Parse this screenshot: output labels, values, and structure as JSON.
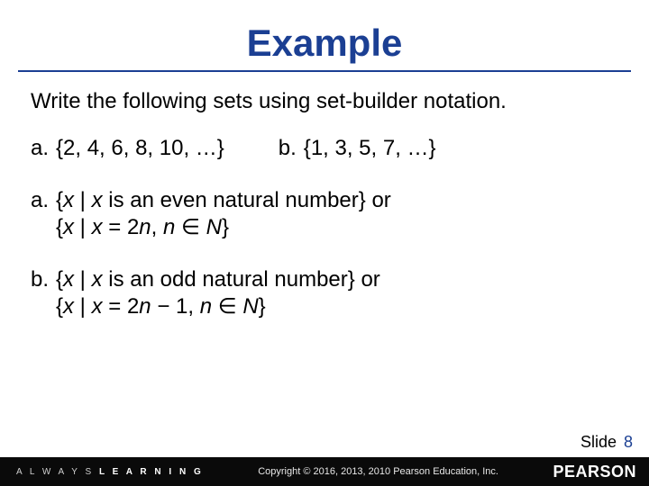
{
  "title": "Example",
  "intro": "Write the following sets using set-builder notation.",
  "qa": {
    "a_label": "a.",
    "a_text": "{2, 4, 6, 8, 10, …}",
    "b_label": "b.",
    "b_text": "{1, 3, 5, 7, …}"
  },
  "ans": {
    "a_label": "a.",
    "a_line1_pre": "{",
    "a_line1_x1": "x",
    "a_line1_mid": " | ",
    "a_line1_x2": "x",
    "a_line1_post": " is an even natural number} or",
    "a_line2_pre": "{",
    "a_line2_x1": "x",
    "a_line2_mid1": " | ",
    "a_line2_x2": "x",
    "a_line2_mid2": " = 2",
    "a_line2_n1": "n",
    "a_line2_mid3": ", ",
    "a_line2_n2": "n",
    "a_line2_mid4": " ∈ ",
    "a_line2_N": "N",
    "a_line2_post": "}",
    "b_label": "b.",
    "b_line1_pre": "{",
    "b_line1_x1": "x",
    "b_line1_mid": " | ",
    "b_line1_x2": "x",
    "b_line1_post": " is an odd natural number} or",
    "b_line2_pre": "{",
    "b_line2_x1": "x",
    "b_line2_mid1": " | ",
    "b_line2_x2": "x",
    "b_line2_mid2": " = 2",
    "b_line2_n1": "n",
    "b_line2_mid3": " − 1, ",
    "b_line2_n2": "n",
    "b_line2_mid4": " ∈ ",
    "b_line2_N": "N",
    "b_line2_post": "}"
  },
  "footer": {
    "always": "A L W A Y S ",
    "learning": "L E A R N I N G",
    "copyright": "Copyright © 2016, 2013, 2010 Pearson Education, Inc.",
    "brand": "PEARSON",
    "slide_label": "Slide",
    "slide_num": "8"
  }
}
